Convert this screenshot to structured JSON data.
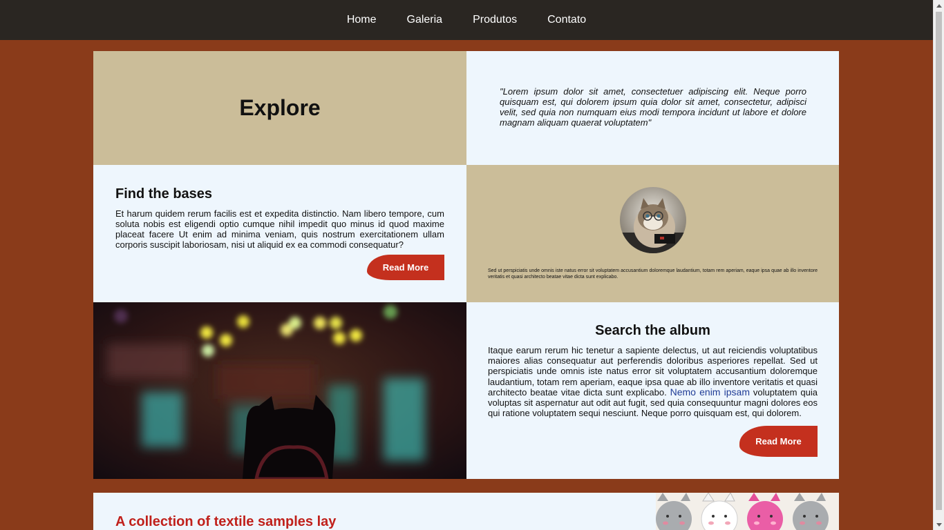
{
  "nav": {
    "items": [
      "Home",
      "Galeria",
      "Produtos",
      "Contato"
    ]
  },
  "explore": {
    "title": "Explore",
    "quote": "\"Lorem ipsum dolor sit amet, consectetuer adipiscing elit. Neque porro quisquam est, qui dolorem ipsum quia dolor sit amet, consectetur, adipisci velit, sed quia non numquam eius modi tempora incidunt ut labore et dolore magnam aliquam quaerat voluptatem\""
  },
  "bases": {
    "title": "Find the bases",
    "text": "Et harum quidem rerum facilis est et expedita distinctio. Nam libero tempore, cum soluta nobis est eligendi optio cumque nihil impedit quo minus id quod maxime placeat facere Ut enim ad minima veniam, quis nostrum exercitationem ullam corporis suscipit laboriosam, nisi ut aliquid ex ea commodi consequatur?",
    "button": "Read More"
  },
  "cat_card": {
    "caption": "Sed ut perspiciatis unde omnis iste natus error sit voluptatem accusantium doloremque laudantium, totam rem aperiam, eaque ipsa quae ab illo inventore veritatis et quasi architecto beatae vitae dicta sunt explicabo."
  },
  "album": {
    "title": "Search the album",
    "text_before": "Itaque earum rerum hic tenetur a sapiente delectus, ut aut reiciendis voluptatibus maiores alias consequatur aut perferendis doloribus asperiores repellat. Sed ut perspiciatis unde omnis iste natus error sit voluptatem accusantium doloremque laudantium, totam rem aperiam, eaque ipsa quae ab illo inventore veritatis et quasi architecto beatae vitae dicta sunt explicabo. ",
    "link": "Nemo enim ipsam",
    "text_after": " voluptatem quia voluptas sit aspernatur aut odit aut fugit, sed quia consequuntur magni dolores eos qui ratione voluptatem sequi nesciunt. Neque porro quisquam est, qui dolorem.",
    "button": "Read More"
  },
  "bottom": {
    "title": "A collection of textile samples lay"
  },
  "colors": {
    "background": "#8a3b1a",
    "navbar": "#2a2622",
    "tan": "#cbbd99",
    "panel": "#eef6fd",
    "button": "#c4301e",
    "heading_red": "#c0201b",
    "link": "#1f3c96"
  }
}
